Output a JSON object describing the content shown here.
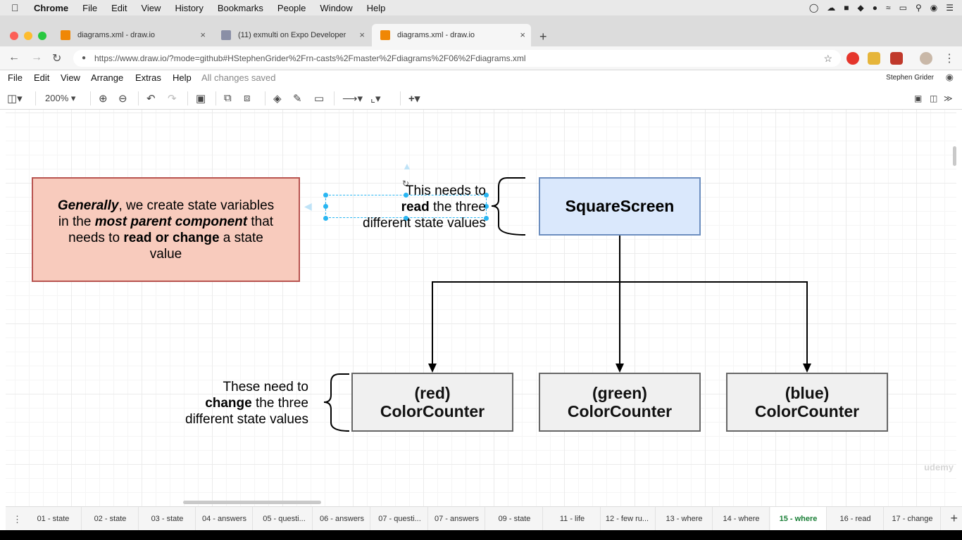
{
  "menubar": {
    "app": "Chrome",
    "items": [
      "File",
      "Edit",
      "View",
      "History",
      "Bookmarks",
      "People",
      "Window",
      "Help"
    ]
  },
  "tabs": [
    {
      "title": "diagrams.xml - draw.io",
      "active": false
    },
    {
      "title": "(11) exmulti on Expo Developer",
      "active": false
    },
    {
      "title": "diagrams.xml - draw.io",
      "active": true
    }
  ],
  "address": {
    "url": "https://www.draw.io/?mode=github#HStephenGrider%2Frn-casts%2Fmaster%2Fdiagrams%2F06%2Fdiagrams.xml"
  },
  "drawio_menu": {
    "items": [
      "File",
      "Edit",
      "View",
      "Arrange",
      "Extras",
      "Help"
    ],
    "status": "All changes saved",
    "user": "Stephen Grider"
  },
  "toolbar": {
    "zoom": "200%"
  },
  "diagram": {
    "note": {
      "line1_italic": "Generally",
      "line1_rest": ", we create state variables",
      "line2_pre": "in the ",
      "line2_italic": "most parent component",
      "line2_post": " that",
      "line3_pre": "needs to ",
      "line3_bold": "read or change",
      "line3_post": " a state",
      "line4": "value"
    },
    "read_label": {
      "line1": "This needs to",
      "line2_bold": "read",
      "line2_rest": " the three",
      "line3": "different state values"
    },
    "square_screen": "SquareScreen",
    "counters": [
      {
        "line1": "(red)",
        "line2": "ColorCounter"
      },
      {
        "line1": "(green)",
        "line2": "ColorCounter"
      },
      {
        "line1": "(blue)",
        "line2": "ColorCounter"
      }
    ],
    "change_label": {
      "line1": "These need to",
      "line2_bold": "change",
      "line2_rest": " the three",
      "line3": "different state values"
    },
    "watermark": "udemy"
  },
  "pages": [
    {
      "label": "01 - state",
      "active": false
    },
    {
      "label": "02 - state",
      "active": false
    },
    {
      "label": "03 - state",
      "active": false
    },
    {
      "label": "04 - answers",
      "active": false
    },
    {
      "label": "05 - questi...",
      "active": false
    },
    {
      "label": "06 - answers",
      "active": false
    },
    {
      "label": "07 - questi...",
      "active": false
    },
    {
      "label": "07 - answers",
      "active": false
    },
    {
      "label": "09 - state",
      "active": false
    },
    {
      "label": "11 - life",
      "active": false
    },
    {
      "label": "12 - few ru...",
      "active": false
    },
    {
      "label": "13 - where",
      "active": false
    },
    {
      "label": "14 - where",
      "active": false
    },
    {
      "label": "15 - where",
      "active": true
    },
    {
      "label": "16 - read",
      "active": false
    },
    {
      "label": "17 - change",
      "active": false
    }
  ],
  "colors": {
    "note_fill": "#f8cbbd",
    "note_stroke": "#b85450",
    "screen_fill": "#dae8fc",
    "screen_stroke": "#6c8ebf",
    "counter_fill": "#f0f0f0",
    "active_page": "#1a7f37",
    "selection": "#29b6f2"
  }
}
